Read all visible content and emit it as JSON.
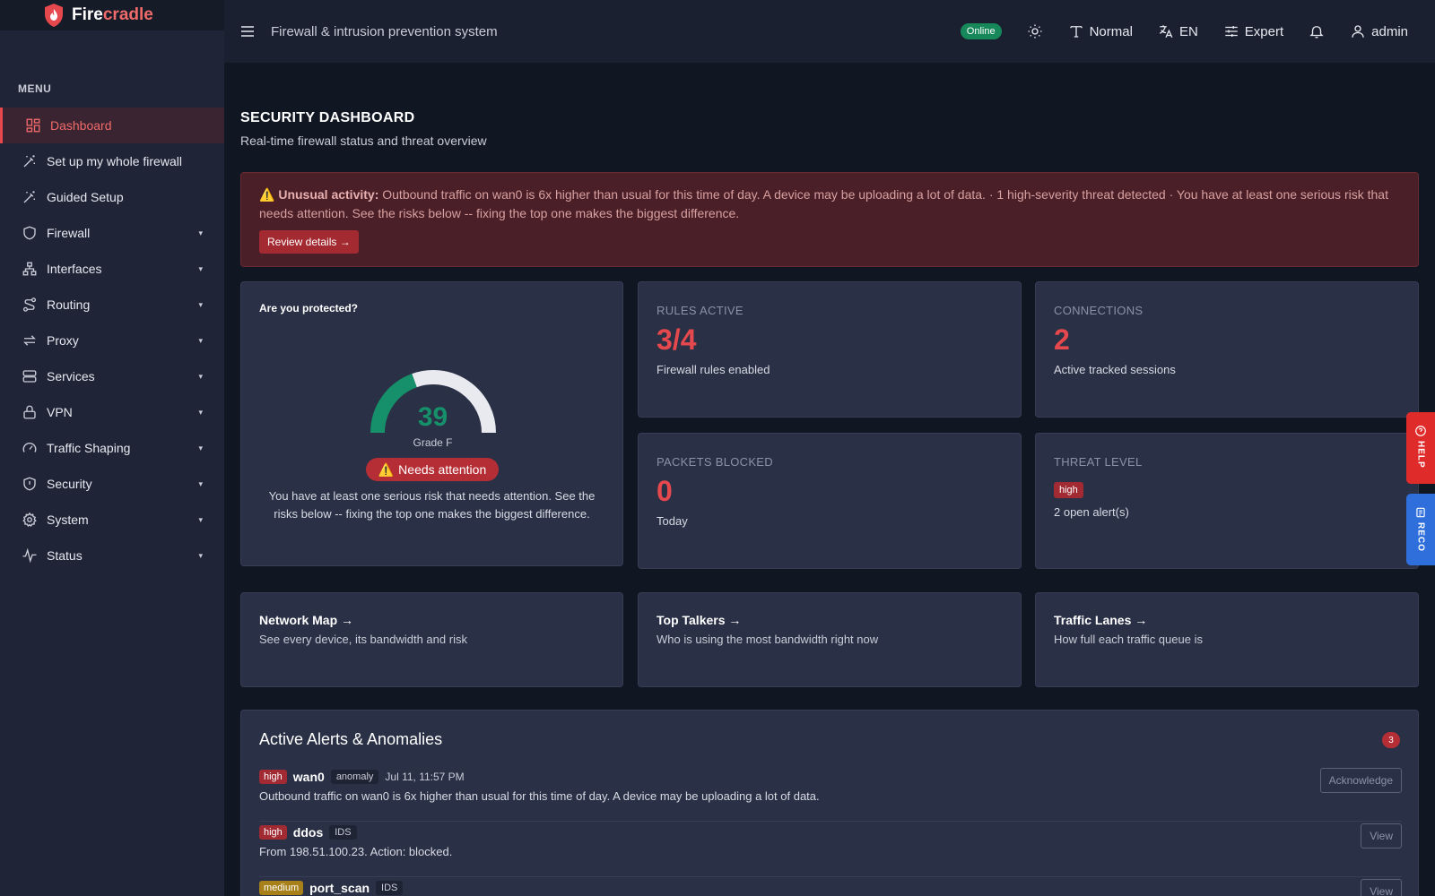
{
  "brand": {
    "name_part1": "Fire",
    "name_part2": "cradle"
  },
  "sidebar": {
    "menu_heading": "MENU",
    "items": [
      {
        "label": "Dashboard",
        "icon": "dashboard-icon",
        "active": true,
        "caret": ""
      },
      {
        "label": "Set up my whole firewall",
        "icon": "wand-icon",
        "caret": ""
      },
      {
        "label": "Guided Setup",
        "icon": "wand-icon",
        "caret": ""
      },
      {
        "label": "Firewall",
        "icon": "shield-icon",
        "caret": "▾"
      },
      {
        "label": "Interfaces",
        "icon": "network-icon",
        "caret": "▾"
      },
      {
        "label": "Routing",
        "icon": "route-icon",
        "caret": "▾"
      },
      {
        "label": "Proxy",
        "icon": "arrows-icon",
        "caret": "▾"
      },
      {
        "label": "Services",
        "icon": "server-icon",
        "caret": "▾"
      },
      {
        "label": "VPN",
        "icon": "lock-icon",
        "caret": "▾"
      },
      {
        "label": "Traffic Shaping",
        "icon": "gauge-icon",
        "caret": "▾"
      },
      {
        "label": "Security",
        "icon": "shield-alert-icon",
        "caret": "▾"
      },
      {
        "label": "System",
        "icon": "gear-icon",
        "caret": "▾"
      },
      {
        "label": "Status",
        "icon": "pulse-icon",
        "caret": "▾"
      }
    ]
  },
  "header": {
    "title": "Firewall & intrusion prevention system",
    "status": "Online",
    "font_mode": "Normal",
    "language": "EN",
    "mode": "Expert",
    "user": "admin"
  },
  "page": {
    "title": "SECURITY DASHBOARD",
    "subtitle": "Real-time firewall status and threat overview"
  },
  "banner": {
    "icon": "⚠️",
    "heading": "Unusual activity:",
    "text": " Outbound traffic on wan0 is 6x higher than usual for this time of day. A device may be uploading a lot of data. · 1 high-severity threat detected · You have at least one serious risk that needs attention. See the risks below -- fixing the top one makes the biggest difference.",
    "button": "Review details →"
  },
  "protection": {
    "title": "Are you protected?",
    "score": "39",
    "score_fraction": 0.39,
    "grade": "Grade F",
    "status": "Needs attention",
    "status_icon": "⚠️",
    "description": "You have at least one serious risk that needs attention. See the risks below -- fixing the top one makes the biggest difference.",
    "color_good": "#16906a",
    "color_track": "#e8eaf0"
  },
  "stats": {
    "rules": {
      "label": "RULES ACTIVE",
      "value": "3/4",
      "desc": "Firewall rules enabled"
    },
    "connections": {
      "label": "CONNECTIONS",
      "value": "2",
      "desc": "Active tracked sessions"
    },
    "packets": {
      "label": "PACKETS BLOCKED",
      "value": "0",
      "desc": "Today"
    },
    "threat": {
      "label": "THREAT LEVEL",
      "badge": "high",
      "desc": "2 open alert(s)"
    }
  },
  "links": [
    {
      "title": "Network Map →",
      "desc": "See every device, its bandwidth and risk"
    },
    {
      "title": "Top Talkers →",
      "desc": "Who is using the most bandwidth right now"
    },
    {
      "title": "Traffic Lanes →",
      "desc": "How full each traffic queue is"
    }
  ],
  "alerts": {
    "title": "Active Alerts & Anomalies",
    "count": "3",
    "rows": [
      {
        "severity": "high",
        "source": "wan0",
        "type": "anomaly",
        "time": "Jul 11, 11:57 PM",
        "message": "Outbound traffic on wan0 is 6x higher than usual for this time of day. A device may be uploading a lot of data.",
        "button": "Acknowledge"
      },
      {
        "severity": "high",
        "source": "ddos",
        "type": "IDS",
        "time": "",
        "message": "From 198.51.100.23. Action: blocked.",
        "button": "View"
      },
      {
        "severity": "medium",
        "source": "port_scan",
        "type": "IDS",
        "time": "",
        "message": "",
        "button": "View"
      }
    ]
  },
  "side_tabs": {
    "help": "HELP",
    "reco": "RECO"
  },
  "colors": {
    "accent": "#e5484d",
    "online": "#16885a",
    "help": "#e02b2b",
    "reco": "#2f6fdc"
  }
}
